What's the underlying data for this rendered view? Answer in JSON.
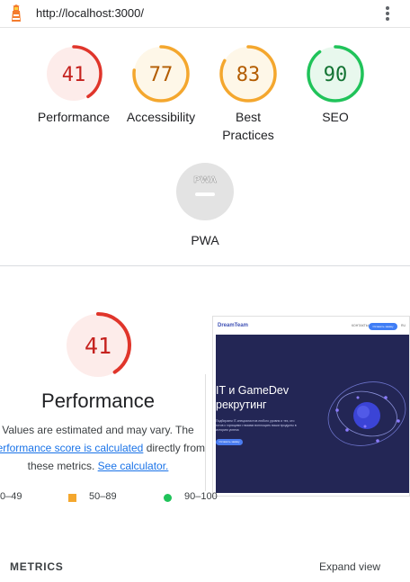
{
  "browser": {
    "url": "http://localhost:3000/"
  },
  "gauges": [
    {
      "value": "41",
      "label": "Performance",
      "score": 41,
      "color": "#e0352b",
      "fill": "#fdecea",
      "text_color": "#c5221f"
    },
    {
      "value": "77",
      "label": "Accessibility",
      "score": 77,
      "color": "#f4a72e",
      "fill": "#fef7e8",
      "text_color": "#b35c00"
    },
    {
      "value": "83",
      "label": "Best Practices",
      "score": 83,
      "color": "#f4a72e",
      "fill": "#fef7e8",
      "text_color": "#b35c00"
    },
    {
      "value": "90",
      "label": "SEO",
      "score": 90,
      "color": "#20c35a",
      "fill": "#e8f8ed",
      "text_color": "#137333"
    }
  ],
  "pwa": {
    "badge": "PWA",
    "label": "PWA"
  },
  "performance": {
    "score": "41",
    "score_value": 41,
    "title": "Performance",
    "desc_line1": "Values are estimated and may vary. The",
    "desc_link1": "performance score is calculated",
    "desc_line2_tail": " directly from",
    "desc_line3": "these metrics. ",
    "desc_link2": "See calculator."
  },
  "screenshot": {
    "brand": "DreamTeam",
    "menu": "КОНТАКТЫ",
    "button": "Оставить заявку",
    "lang": "RU",
    "heading_line1": "IT и GameDev",
    "heading_line2": "рекрутинг",
    "paragraph": "Подбираем IT-специалистов любого уровня и тех, кто готов с горящими глазами воплощать ваши продукты в историю успеха",
    "cta": "Оставить заявку"
  },
  "legend": {
    "fail": "0–49",
    "average": "50–89",
    "pass": "90–100"
  },
  "metrics": {
    "title": "METRICS",
    "expand": "Expand view"
  }
}
